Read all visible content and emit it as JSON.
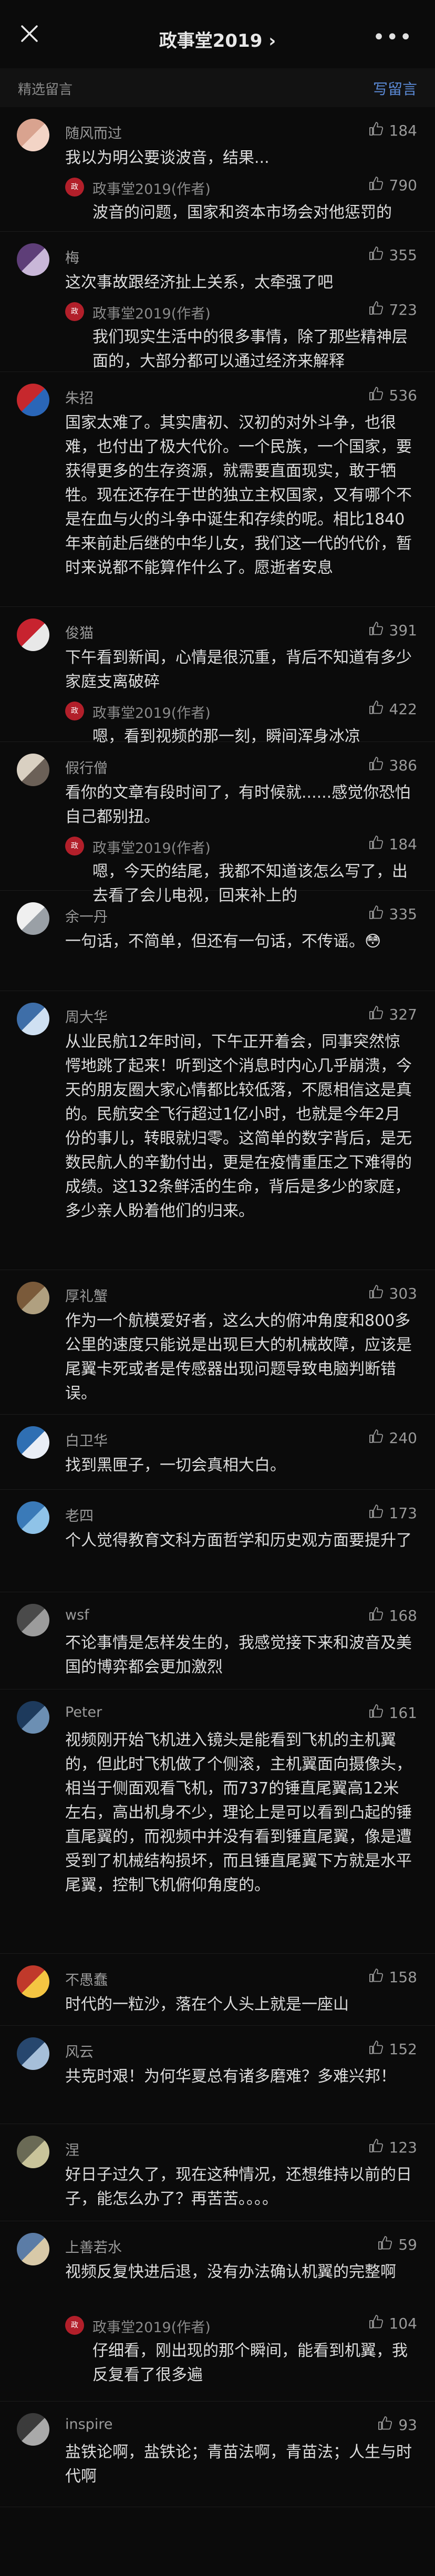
{
  "nav": {
    "title": "政事堂2019 ›",
    "more": "•••"
  },
  "section": {
    "label": "精选留言",
    "action": "写留言"
  },
  "colors": {
    "accent": "#5b8ad6",
    "bg": "#0b0b0b",
    "text": "#dcdcdc",
    "muted": "#9a9a9a"
  },
  "comments": [
    {
      "name": "随风而过",
      "likes": "184",
      "text": "我以为明公要谈波音，结果...",
      "reply": {
        "name": "政事堂2019(作者)",
        "likes": "790",
        "text": "波音的问题，国家和资本市场会对他惩罚的"
      }
    },
    {
      "name": "梅",
      "likes": "355",
      "text": "这次事故跟经济扯上关系，太牵强了吧",
      "reply": {
        "name": "政事堂2019(作者)",
        "likes": "723",
        "text": "我们现实生活中的很多事情，除了那些精神层面的，大部分都可以通过经济来解释"
      }
    },
    {
      "name": "朱招",
      "likes": "536",
      "text": "国家太难了。其实唐初、汉初的对外斗争，也很难，也付出了极大代价。一个民族，一个国家，要获得更多的生存资源，就需要直面现实，敢于牺牲。现在还存在于世的独立主权国家，又有哪个不是在血与火的斗争中诞生和存续的呢。相比1840年来前赴后继的中华儿女，我们这一代的代价，暂时来说都不能算作什么了。愿逝者安息"
    },
    {
      "name": "俊猫",
      "likes": "391",
      "text": "下午看到新闻，心情是很沉重，背后不知道有多少家庭支离破碎",
      "reply": {
        "name": "政事堂2019(作者)",
        "likes": "422",
        "text": "嗯，看到视频的那一刻，瞬间浑身冰凉"
      }
    },
    {
      "name": "假行僧",
      "likes": "386",
      "text": "看你的文章有段时间了，有时候就......感觉你恐怕自己都别扭。",
      "reply": {
        "name": "政事堂2019(作者)",
        "likes": "184",
        "text": "嗯，今天的结尾，我都不知道该怎么写了，出去看了会儿电视，回来补上的"
      }
    },
    {
      "name": "余一丹",
      "likes": "335",
      "text": "一句话，不简单，但还有一句话，不传谣。😳"
    },
    {
      "name": "周大华",
      "likes": "327",
      "text": "从业民航12年时间，下午正开着会，同事突然惊愕地跳了起来！听到这个消息时内心几乎崩溃，今天的朋友圈大家心情都比较低落，不愿相信这是真的。民航安全飞行超过1亿小时，也就是今年2月份的事儿，转眼就归零。这简单的数字背后，是无数民航人的辛勤付出，更是在疫情重压之下难得的成绩。这132条鲜活的生命，背后是多少的家庭，多少亲人盼着他们的归来。"
    },
    {
      "name": "厚礼蟹",
      "likes": "303",
      "text": "作为一个航模爱好者，这么大的俯冲角度和800多公里的速度只能说是出现巨大的机械故障，应该是尾翼卡死或者是传感器出现问题导致电脑判断错误。"
    },
    {
      "name": "白卫华",
      "likes": "240",
      "text": "找到黑匣子，一切会真相大白。"
    },
    {
      "name": "老四",
      "likes": "173",
      "text": "个人觉得教育文科方面哲学和历史观方面要提升了"
    },
    {
      "name": "wsf",
      "likes": "168",
      "text": "不论事情是怎样发生的，我感觉接下来和波音及美国的博弈都会更加激烈"
    },
    {
      "name": "Peter",
      "likes": "161",
      "text": "视频刚开始飞机进入镜头是能看到飞机的主机翼的，但此时飞机做了个侧滚，主机翼面向摄像头，相当于侧面观看飞机，而737的锤直尾翼高12米左右，高出机身不少，理论上是可以看到凸起的锤直尾翼的，而视频中并没有看到锤直尾翼，像是遭受到了机械结构损坏，而且锤直尾翼下方就是水平尾翼，控制飞机俯仰角度的。"
    },
    {
      "name": "不愚蠢",
      "likes": "158",
      "text": "时代的一粒沙，落在个人头上就是一座山"
    },
    {
      "name": "风云",
      "likes": "152",
      "text": "共克时艰！为何华夏总有诸多磨难？多难兴邦！"
    },
    {
      "name": "涅",
      "likes": "123",
      "text": "好日子过久了，现在这种情况，还想维持以前的日子，能怎么办了？再苦苦。。。。"
    },
    {
      "name": "上善若水",
      "likes": "59",
      "text": "视频反复快进后退，没有办法确认机翼的完整啊",
      "reply": {
        "name": "政事堂2019(作者)",
        "likes": "104",
        "text": "仔细看，刚出现的那个瞬间，能看到机翼，我反复看了很多遍"
      }
    },
    {
      "name": "inspire",
      "likes": "93",
      "text": "盐铁论啊，盐铁论；青苗法啊，青苗法；人生与时代啊"
    }
  ]
}
